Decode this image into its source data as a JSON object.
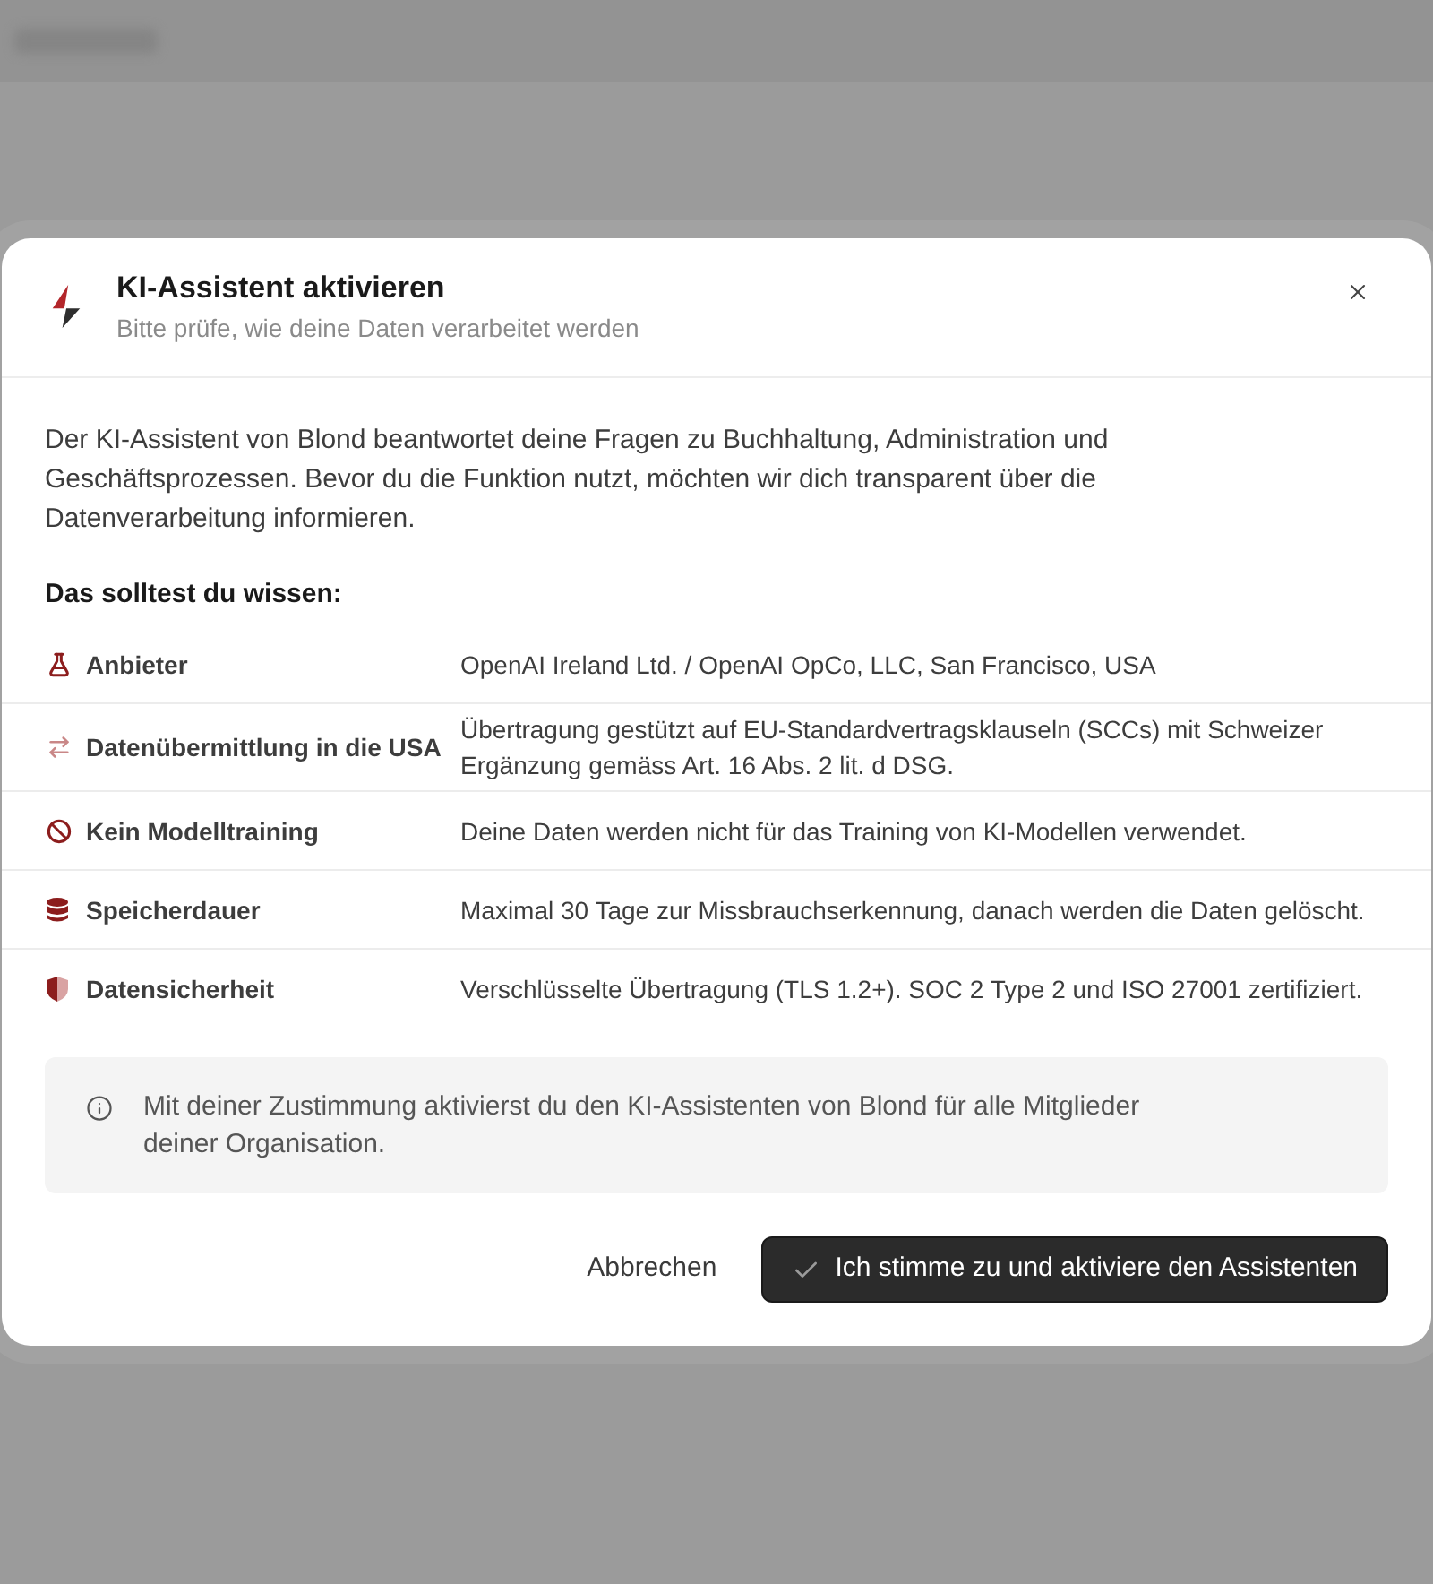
{
  "dialog": {
    "title": "KI-Assistent aktivieren",
    "subtitle": "Bitte prüfe, wie deine Daten verarbeitet werden"
  },
  "intro": "Der KI-Assistent von Blond beantwortet deine Fragen zu Buchhaltung, Administration und Geschäftsprozessen. Bevor du die Funktion nutzt, möchten wir dich transparent über die Datenverarbeitung informieren.",
  "section_heading": "Das solltest du wissen:",
  "facts": [
    {
      "kind": "provider",
      "label": "Anbieter",
      "value": "OpenAI Ireland Ltd. / OpenAI OpCo, LLC, San Francisco, USA"
    },
    {
      "kind": "transfer",
      "label": "Datenübermittlung in die USA",
      "value": "Übertragung gestützt auf EU-Standardvertragsklauseln (SCCs) mit Schweizer Ergänzung gemäss Art. 16 Abs. 2 lit. d DSG."
    },
    {
      "kind": "training",
      "label": "Kein Modelltraining",
      "value": "Deine Daten werden nicht für das Training von KI-Modellen verwendet."
    },
    {
      "kind": "retention",
      "label": "Speicherdauer",
      "value": "Maximal 30 Tage zur Missbrauchserkennung, danach werden die Daten gelöscht."
    },
    {
      "kind": "security",
      "label": "Datensicherheit",
      "value": "Verschlüsselte Übertragung (TLS 1.2+). SOC 2 Type 2 und ISO 27001 zertifiziert."
    }
  ],
  "notice": {
    "text": "Mit deiner Zustimmung aktivierst du den KI-Assistenten von Blond für alle Mitglieder deiner Organisation."
  },
  "buttons": [
    {
      "kind": "secondary",
      "label": "Abbrechen"
    },
    {
      "kind": "primary",
      "label": "Ich stimme zu und aktiviere den Assistenten"
    }
  ]
}
